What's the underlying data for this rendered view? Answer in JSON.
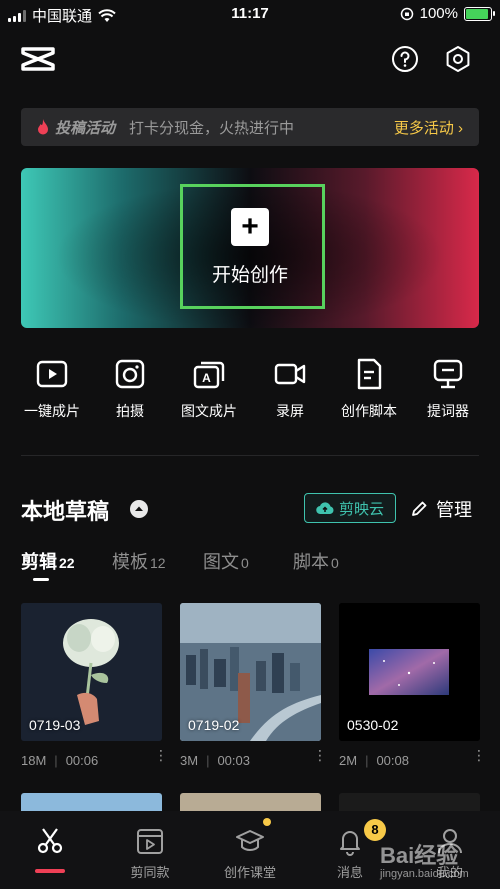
{
  "status_bar": {
    "carrier": "中国联通",
    "time": "11:17",
    "battery": "100%"
  },
  "banner": {
    "tag": "投稿活动",
    "message": "打卡分现金，火热进行中",
    "more": "更多活动 ›"
  },
  "hero": {
    "label": "开始创作",
    "plus": "+"
  },
  "quick_actions": [
    {
      "label": "一键成片",
      "icon": "play-square-icon"
    },
    {
      "label": "拍摄",
      "icon": "camera-icon"
    },
    {
      "label": "图文成片",
      "icon": "text-to-video-icon"
    },
    {
      "label": "录屏",
      "icon": "video-record-icon"
    },
    {
      "label": "创作脚本",
      "icon": "script-doc-icon"
    },
    {
      "label": "提词器",
      "icon": "teleprompter-icon"
    }
  ],
  "drafts": {
    "title": "本地草稿",
    "cloud_button": "剪映云",
    "manage": "管理",
    "tabs": [
      {
        "label": "剪辑",
        "count": "22",
        "active": true
      },
      {
        "label": "模板",
        "count": "12"
      },
      {
        "label": "图文",
        "count": "0"
      },
      {
        "label": "脚本",
        "count": "0"
      }
    ],
    "items": [
      {
        "name": "0719-03",
        "size": "18M",
        "duration": "00:06"
      },
      {
        "name": "0719-02",
        "size": "3M",
        "duration": "00:03"
      },
      {
        "name": "0530-02",
        "size": "2M",
        "duration": "00:08"
      }
    ]
  },
  "tab_bar": [
    {
      "label": "",
      "icon": "scissors-icon",
      "active": true
    },
    {
      "label": "剪同款",
      "icon": "clapper-icon"
    },
    {
      "label": "创作课堂",
      "icon": "graduation-cap-icon"
    },
    {
      "label": "消息",
      "icon": "bell-icon",
      "badge": "8"
    },
    {
      "label": "我的",
      "icon": "person-icon"
    }
  ],
  "watermark": {
    "text": "Bai经验",
    "sub": "jingyan.baidu.com"
  },
  "colors": {
    "accent": "#3fc3ae",
    "highlight": "#f7c948",
    "active": "#ef4056",
    "frame": "#58d25d"
  }
}
